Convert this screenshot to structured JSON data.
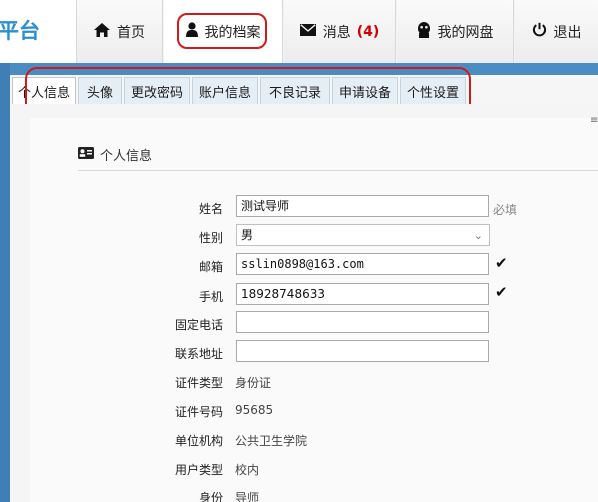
{
  "brand": {
    "text": "平台"
  },
  "nav": [
    {
      "label": "首页",
      "icon": "home-icon"
    },
    {
      "label": "我的档案",
      "icon": "user-icon"
    },
    {
      "label": "消息",
      "icon": "envelope-icon",
      "badge": "(4)"
    },
    {
      "label": "我的网盘",
      "icon": "cloud-disk-icon"
    },
    {
      "label": "退出",
      "icon": "power-icon"
    }
  ],
  "tabs": [
    {
      "label": "个人信息",
      "active": true
    },
    {
      "label": "头像"
    },
    {
      "label": "更改密码"
    },
    {
      "label": "账户信息"
    },
    {
      "label": "不良记录"
    },
    {
      "label": "申请设备"
    },
    {
      "label": "个性设置"
    }
  ],
  "section": {
    "title": "个人信息",
    "icon": "id-card-icon"
  },
  "form": {
    "name": {
      "label": "姓名",
      "value": "测试导师",
      "hint": "必填"
    },
    "gender": {
      "label": "性别",
      "value": "男"
    },
    "email": {
      "label": "邮箱",
      "value": "sslin0898@163.com"
    },
    "phone": {
      "label": "手机",
      "value": "18928748633"
    },
    "landline": {
      "label": "固定电话",
      "value": ""
    },
    "address": {
      "label": "联系地址",
      "value": ""
    },
    "id_type": {
      "label": "证件类型",
      "value": "身份证"
    },
    "id_number": {
      "label": "证件号码",
      "value": "95685"
    },
    "org": {
      "label": "单位机构",
      "value": "公共卫生学院"
    },
    "user_type": {
      "label": "用户类型",
      "value": "校内"
    },
    "identity": {
      "label": "身份",
      "value": "导师"
    }
  },
  "colors": {
    "accent_blue": "#4b8dc3",
    "brand_blue": "#2b8fd1",
    "badge_red": "#d40000",
    "annotation_red": "#d11a1a"
  }
}
